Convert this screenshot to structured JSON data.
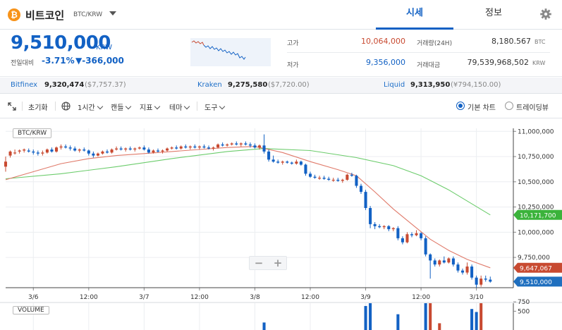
{
  "header": {
    "coin_symbol_glyph": "₿",
    "coin_name": "비트코인",
    "coin_pair": "BTC/KRW",
    "tabs": [
      {
        "label": "시세",
        "active": true
      },
      {
        "label": "정보",
        "active": false
      }
    ],
    "settings_icon": "gear-icon"
  },
  "summary": {
    "price": "9,510,000",
    "price_unit": "KRW",
    "change_label": "전일대비",
    "change_pct": "-3.71%",
    "change_abs": "▼-366,000",
    "high_label": "고가",
    "high_value": "10,064,000",
    "low_label": "저가",
    "low_value": "9,356,000",
    "volume_label": "거래량(24H)",
    "volume_value": "8,180.567",
    "volume_unit": "BTC",
    "amount_label": "거래대금",
    "amount_value": "79,539,968,502",
    "amount_unit": "KRW"
  },
  "exchanges": [
    {
      "name": "Bitfinex",
      "price": "9,320,474",
      "usd": "($7,757.37)"
    },
    {
      "name": "Kraken",
      "price": "9,275,580",
      "usd": "($7,720.00)"
    },
    {
      "name": "Liquid",
      "price": "9,313,950",
      "usd": "(¥794,150.00)"
    }
  ],
  "toolbar": {
    "fullscreen_icon": "expand-icon",
    "reset_label": "초기화",
    "globe_icon": "globe-icon",
    "interval_label": "1시간",
    "candle_label": "캔들",
    "indicator_label": "지표",
    "theme_label": "테마",
    "tools_label": "도구",
    "basic_chart_label": "기본 차트",
    "tradingview_label": "트레이딩뷰"
  },
  "colors": {
    "up": "#c84a31",
    "down": "#1261c4",
    "ma_short": "#e07a6a",
    "ma_long": "#6ccc6c",
    "ma_short_tag": "#c84a31",
    "ma_long_tag": "#3bb33b",
    "price_tag": "#1f6fbf"
  },
  "chart_data": {
    "type": "candlestick",
    "title": "BTC/KRW",
    "y_tick_labels": [
      "11,000,000",
      "10,750,000",
      "10,500,000",
      "10,250,000",
      "10,000,000",
      "9,750,000"
    ],
    "y_ticks": [
      11000000,
      10750000,
      10500000,
      10250000,
      10000000,
      9750000
    ],
    "ylim": [
      9450000,
      11030000
    ],
    "x_tick_labels": [
      "3/6",
      "12:00",
      "3/7",
      "12:00",
      "3/8",
      "12:00",
      "3/9",
      "12:00",
      "3/10"
    ],
    "x_tick_hours": [
      0,
      12,
      24,
      36,
      48,
      60,
      72,
      84,
      96
    ],
    "x_range_hours": [
      -6,
      104
    ],
    "grid": true,
    "price_tags": [
      {
        "label": "10,171,700",
        "value": 10171700,
        "series": "ma_long"
      },
      {
        "label": "9,647,067",
        "value": 9647067,
        "series": "ma_short"
      },
      {
        "label": "9,510,000",
        "value": 9510000,
        "series": "price"
      }
    ],
    "candles": [
      {
        "t": -6,
        "o": 10650000,
        "h": 10750000,
        "l": 10600000,
        "c": 10700000
      },
      {
        "t": -5,
        "o": 10760000,
        "h": 10810000,
        "l": 10740000,
        "c": 10800000
      },
      {
        "t": -4,
        "o": 10790000,
        "h": 10820000,
        "l": 10770000,
        "c": 10790000
      },
      {
        "t": -3,
        "o": 10800000,
        "h": 10820000,
        "l": 10780000,
        "c": 10810000
      },
      {
        "t": -2,
        "o": 10810000,
        "h": 10830000,
        "l": 10790000,
        "c": 10820000
      },
      {
        "t": -1,
        "o": 10810000,
        "h": 10830000,
        "l": 10790000,
        "c": 10800000
      },
      {
        "t": 0,
        "o": 10800000,
        "h": 10820000,
        "l": 10770000,
        "c": 10790000
      },
      {
        "t": 1,
        "o": 10790000,
        "h": 10810000,
        "l": 10760000,
        "c": 10780000
      },
      {
        "t": 2,
        "o": 10780000,
        "h": 10810000,
        "l": 10760000,
        "c": 10790000
      },
      {
        "t": 3,
        "o": 10790000,
        "h": 10830000,
        "l": 10780000,
        "c": 10820000
      },
      {
        "t": 4,
        "o": 10820000,
        "h": 10840000,
        "l": 10790000,
        "c": 10800000
      },
      {
        "t": 5,
        "o": 10800000,
        "h": 10850000,
        "l": 10790000,
        "c": 10840000
      },
      {
        "t": 6,
        "o": 10840000,
        "h": 10870000,
        "l": 10820000,
        "c": 10850000
      },
      {
        "t": 7,
        "o": 10850000,
        "h": 10870000,
        "l": 10830000,
        "c": 10840000
      },
      {
        "t": 8,
        "o": 10840000,
        "h": 10860000,
        "l": 10810000,
        "c": 10830000
      },
      {
        "t": 9,
        "o": 10830000,
        "h": 10850000,
        "l": 10800000,
        "c": 10810000
      },
      {
        "t": 10,
        "o": 10810000,
        "h": 10830000,
        "l": 10790000,
        "c": 10820000
      },
      {
        "t": 11,
        "o": 10820000,
        "h": 10840000,
        "l": 10800000,
        "c": 10810000
      },
      {
        "t": 12,
        "o": 10810000,
        "h": 10820000,
        "l": 10760000,
        "c": 10780000
      },
      {
        "t": 13,
        "o": 10780000,
        "h": 10800000,
        "l": 10740000,
        "c": 10760000
      },
      {
        "t": 14,
        "o": 10760000,
        "h": 10790000,
        "l": 10750000,
        "c": 10780000
      },
      {
        "t": 15,
        "o": 10780000,
        "h": 10810000,
        "l": 10770000,
        "c": 10800000
      },
      {
        "t": 16,
        "o": 10800000,
        "h": 10820000,
        "l": 10780000,
        "c": 10790000
      },
      {
        "t": 17,
        "o": 10790000,
        "h": 10830000,
        "l": 10780000,
        "c": 10820000
      },
      {
        "t": 18,
        "o": 10820000,
        "h": 10850000,
        "l": 10810000,
        "c": 10830000
      },
      {
        "t": 19,
        "o": 10830000,
        "h": 10850000,
        "l": 10810000,
        "c": 10820000
      },
      {
        "t": 20,
        "o": 10820000,
        "h": 10840000,
        "l": 10800000,
        "c": 10830000
      },
      {
        "t": 21,
        "o": 10830000,
        "h": 10850000,
        "l": 10810000,
        "c": 10820000
      },
      {
        "t": 22,
        "o": 10820000,
        "h": 10840000,
        "l": 10800000,
        "c": 10830000
      },
      {
        "t": 23,
        "o": 10830000,
        "h": 10850000,
        "l": 10820000,
        "c": 10840000
      },
      {
        "t": 24,
        "o": 10840000,
        "h": 10860000,
        "l": 10810000,
        "c": 10820000
      },
      {
        "t": 25,
        "o": 10820000,
        "h": 10840000,
        "l": 10780000,
        "c": 10790000
      },
      {
        "t": 26,
        "o": 10790000,
        "h": 10820000,
        "l": 10780000,
        "c": 10810000
      },
      {
        "t": 27,
        "o": 10810000,
        "h": 10830000,
        "l": 10790000,
        "c": 10800000
      },
      {
        "t": 28,
        "o": 10800000,
        "h": 10820000,
        "l": 10780000,
        "c": 10810000
      },
      {
        "t": 29,
        "o": 10810000,
        "h": 10840000,
        "l": 10800000,
        "c": 10830000
      },
      {
        "t": 30,
        "o": 10830000,
        "h": 10850000,
        "l": 10820000,
        "c": 10840000
      },
      {
        "t": 31,
        "o": 10840000,
        "h": 10860000,
        "l": 10820000,
        "c": 10830000
      },
      {
        "t": 32,
        "o": 10830000,
        "h": 10860000,
        "l": 10820000,
        "c": 10850000
      },
      {
        "t": 33,
        "o": 10850000,
        "h": 10870000,
        "l": 10830000,
        "c": 10840000
      },
      {
        "t": 34,
        "o": 10840000,
        "h": 10860000,
        "l": 10820000,
        "c": 10850000
      },
      {
        "t": 35,
        "o": 10850000,
        "h": 10870000,
        "l": 10830000,
        "c": 10840000
      },
      {
        "t": 36,
        "o": 10840000,
        "h": 10860000,
        "l": 10820000,
        "c": 10850000
      },
      {
        "t": 37,
        "o": 10850000,
        "h": 10870000,
        "l": 10830000,
        "c": 10840000
      },
      {
        "t": 38,
        "o": 10840000,
        "h": 10860000,
        "l": 10820000,
        "c": 10830000
      },
      {
        "t": 39,
        "o": 10830000,
        "h": 10850000,
        "l": 10810000,
        "c": 10840000
      },
      {
        "t": 40,
        "o": 10840000,
        "h": 10880000,
        "l": 10830000,
        "c": 10870000
      },
      {
        "t": 41,
        "o": 10870000,
        "h": 10890000,
        "l": 10850000,
        "c": 10860000
      },
      {
        "t": 42,
        "o": 10860000,
        "h": 10880000,
        "l": 10850000,
        "c": 10870000
      },
      {
        "t": 43,
        "o": 10870000,
        "h": 10890000,
        "l": 10860000,
        "c": 10880000
      },
      {
        "t": 44,
        "o": 10880000,
        "h": 10900000,
        "l": 10860000,
        "c": 10870000
      },
      {
        "t": 45,
        "o": 10870000,
        "h": 10890000,
        "l": 10850000,
        "c": 10880000
      },
      {
        "t": 46,
        "o": 10880000,
        "h": 10900000,
        "l": 10860000,
        "c": 10870000
      },
      {
        "t": 47,
        "o": 10870000,
        "h": 10890000,
        "l": 10840000,
        "c": 10860000
      },
      {
        "t": 48,
        "o": 10860000,
        "h": 10880000,
        "l": 10830000,
        "c": 10840000
      },
      {
        "t": 49,
        "o": 10840000,
        "h": 10870000,
        "l": 10820000,
        "c": 10860000
      },
      {
        "t": 50,
        "o": 10860000,
        "h": 10970000,
        "l": 10780000,
        "c": 10800000
      },
      {
        "t": 51,
        "o": 10800000,
        "h": 10820000,
        "l": 10700000,
        "c": 10720000
      },
      {
        "t": 52,
        "o": 10720000,
        "h": 10760000,
        "l": 10690000,
        "c": 10700000
      },
      {
        "t": 53,
        "o": 10700000,
        "h": 10720000,
        "l": 10680000,
        "c": 10690000
      },
      {
        "t": 54,
        "o": 10690000,
        "h": 10710000,
        "l": 10670000,
        "c": 10700000
      },
      {
        "t": 55,
        "o": 10700000,
        "h": 10710000,
        "l": 10680000,
        "c": 10690000
      },
      {
        "t": 56,
        "o": 10690000,
        "h": 10700000,
        "l": 10670000,
        "c": 10680000
      },
      {
        "t": 57,
        "o": 10680000,
        "h": 10720000,
        "l": 10670000,
        "c": 10700000
      },
      {
        "t": 58,
        "o": 10700000,
        "h": 10710000,
        "l": 10660000,
        "c": 10670000
      },
      {
        "t": 59,
        "o": 10670000,
        "h": 10680000,
        "l": 10560000,
        "c": 10580000
      },
      {
        "t": 60,
        "o": 10580000,
        "h": 10600000,
        "l": 10540000,
        "c": 10550000
      },
      {
        "t": 61,
        "o": 10550000,
        "h": 10570000,
        "l": 10530000,
        "c": 10540000
      },
      {
        "t": 62,
        "o": 10540000,
        "h": 10560000,
        "l": 10520000,
        "c": 10540000
      },
      {
        "t": 63,
        "o": 10540000,
        "h": 10560000,
        "l": 10520000,
        "c": 10530000
      },
      {
        "t": 64,
        "o": 10530000,
        "h": 10550000,
        "l": 10510000,
        "c": 10520000
      },
      {
        "t": 65,
        "o": 10520000,
        "h": 10540000,
        "l": 10500000,
        "c": 10520000
      },
      {
        "t": 66,
        "o": 10520000,
        "h": 10540000,
        "l": 10500000,
        "c": 10510000
      },
      {
        "t": 67,
        "o": 10510000,
        "h": 10530000,
        "l": 10490000,
        "c": 10520000
      },
      {
        "t": 68,
        "o": 10520000,
        "h": 10580000,
        "l": 10510000,
        "c": 10570000
      },
      {
        "t": 69,
        "o": 10570000,
        "h": 10590000,
        "l": 10550000,
        "c": 10560000
      },
      {
        "t": 70,
        "o": 10560000,
        "h": 10570000,
        "l": 10440000,
        "c": 10460000
      },
      {
        "t": 71,
        "o": 10460000,
        "h": 10480000,
        "l": 10380000,
        "c": 10400000
      },
      {
        "t": 72,
        "o": 10400000,
        "h": 10420000,
        "l": 10220000,
        "c": 10240000
      },
      {
        "t": 73,
        "o": 10240000,
        "h": 10260000,
        "l": 10040000,
        "c": 10080000
      },
      {
        "t": 74,
        "o": 10080000,
        "h": 10100000,
        "l": 10030000,
        "c": 10060000
      },
      {
        "t": 75,
        "o": 10060000,
        "h": 10080000,
        "l": 10040000,
        "c": 10050000
      },
      {
        "t": 76,
        "o": 10050000,
        "h": 10070000,
        "l": 10030000,
        "c": 10060000
      },
      {
        "t": 77,
        "o": 10060000,
        "h": 10070000,
        "l": 10010000,
        "c": 10030000
      },
      {
        "t": 78,
        "o": 10030000,
        "h": 10050000,
        "l": 10010000,
        "c": 10040000
      },
      {
        "t": 79,
        "o": 10040000,
        "h": 10060000,
        "l": 9920000,
        "c": 9940000
      },
      {
        "t": 80,
        "o": 9940000,
        "h": 9960000,
        "l": 9880000,
        "c": 9900000
      },
      {
        "t": 81,
        "o": 9900000,
        "h": 10000000,
        "l": 9890000,
        "c": 9980000
      },
      {
        "t": 82,
        "o": 9980000,
        "h": 10000000,
        "l": 9950000,
        "c": 9970000
      },
      {
        "t": 83,
        "o": 9970000,
        "h": 10020000,
        "l": 9960000,
        "c": 9990000
      },
      {
        "t": 84,
        "o": 9990000,
        "h": 10000000,
        "l": 9920000,
        "c": 9940000
      },
      {
        "t": 85,
        "o": 9940000,
        "h": 9960000,
        "l": 9760000,
        "c": 9780000
      },
      {
        "t": 86,
        "o": 9780000,
        "h": 9790000,
        "l": 9540000,
        "c": 9720000
      },
      {
        "t": 87,
        "o": 9720000,
        "h": 9740000,
        "l": 9660000,
        "c": 9680000
      },
      {
        "t": 88,
        "o": 9680000,
        "h": 9730000,
        "l": 9660000,
        "c": 9720000
      },
      {
        "t": 89,
        "o": 9720000,
        "h": 9760000,
        "l": 9690000,
        "c": 9700000
      },
      {
        "t": 90,
        "o": 9700000,
        "h": 9750000,
        "l": 9690000,
        "c": 9740000
      },
      {
        "t": 91,
        "o": 9740000,
        "h": 9760000,
        "l": 9660000,
        "c": 9680000
      },
      {
        "t": 92,
        "o": 9680000,
        "h": 9700000,
        "l": 9600000,
        "c": 9620000
      },
      {
        "t": 93,
        "o": 9620000,
        "h": 9640000,
        "l": 9580000,
        "c": 9600000
      },
      {
        "t": 94,
        "o": 9600000,
        "h": 9700000,
        "l": 9580000,
        "c": 9660000
      },
      {
        "t": 95,
        "o": 9660000,
        "h": 9680000,
        "l": 9530000,
        "c": 9550000
      },
      {
        "t": 96,
        "o": 9550000,
        "h": 9570000,
        "l": 9450000,
        "c": 9480000
      },
      {
        "t": 97,
        "o": 9480000,
        "h": 9570000,
        "l": 9460000,
        "c": 9540000
      },
      {
        "t": 98,
        "o": 9540000,
        "h": 9570000,
        "l": 9510000,
        "c": 9530000
      },
      {
        "t": 99,
        "o": 9530000,
        "h": 9560000,
        "l": 9500000,
        "c": 9510000
      }
    ],
    "ma_short": [
      [
        -6,
        10520000
      ],
      [
        0,
        10600000
      ],
      [
        6,
        10680000
      ],
      [
        12,
        10730000
      ],
      [
        18,
        10760000
      ],
      [
        24,
        10780000
      ],
      [
        30,
        10800000
      ],
      [
        36,
        10820000
      ],
      [
        42,
        10840000
      ],
      [
        48,
        10850000
      ],
      [
        54,
        10790000
      ],
      [
        60,
        10700000
      ],
      [
        66,
        10620000
      ],
      [
        70,
        10560000
      ],
      [
        74,
        10400000
      ],
      [
        78,
        10230000
      ],
      [
        82,
        10080000
      ],
      [
        86,
        9930000
      ],
      [
        90,
        9820000
      ],
      [
        94,
        9730000
      ],
      [
        99,
        9647067
      ]
    ],
    "ma_long": [
      [
        -6,
        10530000
      ],
      [
        6,
        10580000
      ],
      [
        18,
        10650000
      ],
      [
        30,
        10730000
      ],
      [
        42,
        10800000
      ],
      [
        50,
        10830000
      ],
      [
        60,
        10810000
      ],
      [
        70,
        10740000
      ],
      [
        78,
        10660000
      ],
      [
        84,
        10560000
      ],
      [
        90,
        10420000
      ],
      [
        99,
        10171700
      ]
    ],
    "volume": {
      "label": "VOLUME",
      "y_tick_labels": [
        "750",
        "500"
      ],
      "y_ticks": [
        750,
        500
      ],
      "ylim": [
        0,
        1000
      ],
      "bars": [
        {
          "t": 50,
          "v": 200,
          "dir": "down"
        },
        {
          "t": 72,
          "v": 640,
          "dir": "down"
        },
        {
          "t": 73,
          "v": 770,
          "dir": "down"
        },
        {
          "t": 79,
          "v": 420,
          "dir": "down"
        },
        {
          "t": 85,
          "v": 930,
          "dir": "down"
        },
        {
          "t": 86,
          "v": 870,
          "dir": "up"
        },
        {
          "t": 88,
          "v": 180,
          "dir": "up"
        },
        {
          "t": 95,
          "v": 560,
          "dir": "down"
        },
        {
          "t": 96,
          "v": 480,
          "dir": "down"
        },
        {
          "t": 97,
          "v": 760,
          "dir": "up"
        }
      ]
    }
  }
}
